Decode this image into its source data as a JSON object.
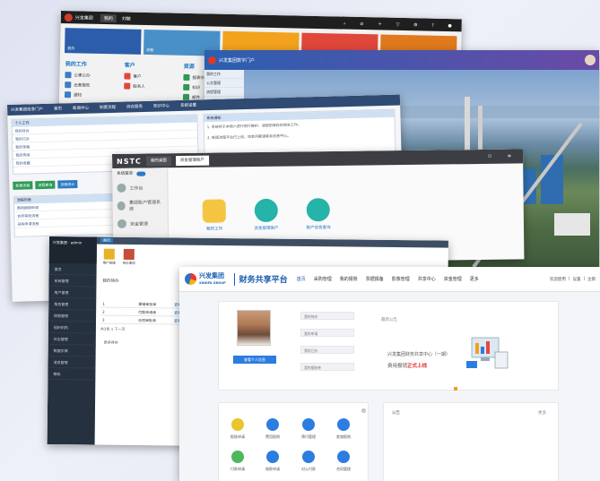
{
  "w1": {
    "brand": "兴发集团",
    "menu": "我的",
    "user": "刘敏",
    "tiles": [
      "首页",
      "流程",
      "IT服务",
      "信息",
      "知识"
    ],
    "groups": [
      {
        "title": "我的工作",
        "items": [
          "公事公办",
          "出差报告",
          "通知"
        ]
      },
      {
        "title": "客户",
        "items": [
          "客户",
          "联系人"
        ]
      },
      {
        "title": "资源",
        "items": [
          "报表中心",
          "知识",
          "邮件"
        ]
      }
    ]
  },
  "w2": {
    "brand": "兴发集团数字门户",
    "sidebar": [
      "我的工作",
      "公文管理",
      "流程管理",
      "人力资源",
      "信息中心",
      "系统设置"
    ]
  },
  "w3": {
    "title": "兴发集团信息门户",
    "nav": [
      "首页",
      "新闻中心",
      "制度流程",
      "综合服务",
      "知识中心",
      "系统设置"
    ],
    "left_header": "个人工作",
    "left_items": [
      "我的待办",
      "我的已办",
      "我的草稿",
      "我的传阅",
      "我的收藏"
    ],
    "buttons": [
      "新建流程",
      "流程查询",
      "流程统计"
    ],
    "list_header": "流程列表",
    "list_items": [
      "费用报销申请",
      "合同审批流程",
      "采购申请流程"
    ],
    "notice_header": "系统通知",
    "notice_lines": [
      "1. 系统将于本周六进行例行维护，请提前保存好相关工作。",
      "2. 新版流程平台已上线，如有问题请联系信息中心。"
    ]
  },
  "w4": {
    "brand": "NSTC",
    "tabs": [
      "我的桌面",
      "资金管理账户"
    ],
    "side_toggle": "系统菜单",
    "side_items": [
      "工作台",
      "集团账户管理系统",
      "资金管理"
    ],
    "shortcuts": [
      "我的工作",
      "资金管理账户",
      "账户信息查询"
    ]
  },
  "w5": {
    "logo_text": "兴发集团",
    "user": "admin",
    "side_items": [
      "首页",
      "系统管理",
      "用户管理",
      "角色管理",
      "权限管理",
      "组织机构",
      "日志管理",
      "数据字典",
      "消息管理",
      "帮助"
    ],
    "top_tab": "首页",
    "quick_icons": [
      "用户管理",
      "待办事项"
    ],
    "section": "我的待办",
    "table": [
      {
        "no": "1",
        "title": "报销审批单",
        "link": "查看"
      },
      {
        "no": "2",
        "title": "付款申请单",
        "link": "查看"
      },
      {
        "no": "3",
        "title": "合同审批单",
        "link": "查看"
      }
    ],
    "pager": "共3条  1  下一页",
    "footer_link": "更多待办"
  },
  "w6": {
    "brand": "兴发集团",
    "brand_sub": "XINGFA GROUP",
    "title": "财务共享平台",
    "nav": [
      "首页",
      "采购管理",
      "我的报账",
      "票据报备",
      "影像管理",
      "共享中心",
      "资金管理",
      "更多"
    ],
    "right_links": [
      "欢迎使用",
      "设置",
      "注销"
    ],
    "profile_btn": "查看个人信息",
    "info_rows": [
      "我的待办",
      "我的申请",
      "我的已办",
      "我的报账单"
    ],
    "announcement_title": "最新公告",
    "announcement_line1": "兴发集团财务共享中心（一期）",
    "announcement_line2_a": "费用报销",
    "announcement_line2_b": "正式上线",
    "quick_labels": [
      "报账申请",
      "费用报销",
      "预付管理",
      "差旅报销",
      "付款申请",
      "借款申请",
      "对公付款",
      "合同管理"
    ],
    "notice_title": "公告",
    "notice_more": "更多"
  }
}
